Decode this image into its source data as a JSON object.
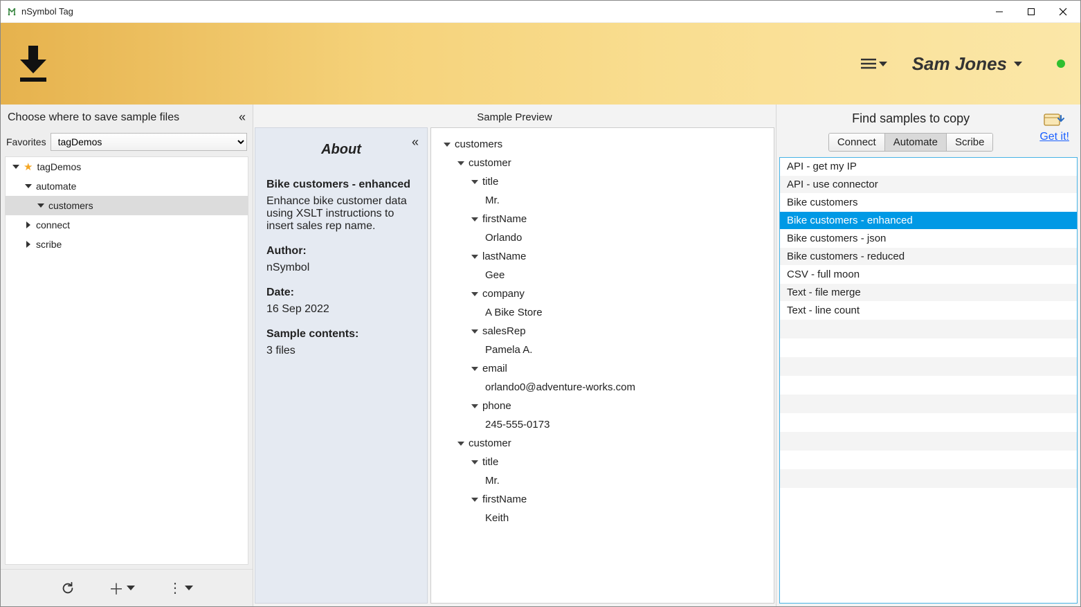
{
  "window": {
    "title": "nSymbol Tag"
  },
  "header": {
    "username": "Sam Jones"
  },
  "leftPanel": {
    "title": "Choose where to save sample files",
    "favoritesLabel": "Favorites",
    "favoritesSelected": "tagDemos",
    "tree": [
      {
        "label": "tagDemos",
        "depth": 0,
        "open": true,
        "starred": true
      },
      {
        "label": "automate",
        "depth": 1,
        "open": true
      },
      {
        "label": "customers",
        "depth": 2,
        "open": true,
        "selected": true
      },
      {
        "label": "connect",
        "depth": 1,
        "open": false
      },
      {
        "label": "scribe",
        "depth": 1,
        "open": false
      }
    ]
  },
  "preview": {
    "header": "Sample Preview"
  },
  "about": {
    "heading": "About",
    "title": "Bike customers - enhanced",
    "description": "Enhance bike customer data using XSLT instructions to insert sales rep name.",
    "authorLabel": "Author:",
    "author": "nSymbol",
    "dateLabel": "Date:",
    "date": "16 Sep 2022",
    "contentsLabel": "Sample contents:",
    "contents": "3 files"
  },
  "dataTree": [
    {
      "depth": 0,
      "label": "customers",
      "node": true
    },
    {
      "depth": 1,
      "label": "customer",
      "node": true
    },
    {
      "depth": 2,
      "label": "title",
      "node": true
    },
    {
      "depth": 3,
      "label": "Mr.",
      "node": false
    },
    {
      "depth": 2,
      "label": "firstName",
      "node": true
    },
    {
      "depth": 3,
      "label": "Orlando",
      "node": false
    },
    {
      "depth": 2,
      "label": "lastName",
      "node": true
    },
    {
      "depth": 3,
      "label": "Gee",
      "node": false
    },
    {
      "depth": 2,
      "label": "company",
      "node": true
    },
    {
      "depth": 3,
      "label": "A Bike Store",
      "node": false
    },
    {
      "depth": 2,
      "label": "salesRep",
      "node": true
    },
    {
      "depth": 3,
      "label": "Pamela A.",
      "node": false
    },
    {
      "depth": 2,
      "label": "email",
      "node": true
    },
    {
      "depth": 3,
      "label": "orlando0@adventure-works.com",
      "node": false
    },
    {
      "depth": 2,
      "label": "phone",
      "node": true
    },
    {
      "depth": 3,
      "label": "245-555-0173",
      "node": false
    },
    {
      "depth": 1,
      "label": "customer",
      "node": true
    },
    {
      "depth": 2,
      "label": "title",
      "node": true
    },
    {
      "depth": 3,
      "label": "Mr.",
      "node": false
    },
    {
      "depth": 2,
      "label": "firstName",
      "node": true
    },
    {
      "depth": 3,
      "label": "Keith",
      "node": false
    }
  ],
  "rightPanel": {
    "title": "Find samples to copy",
    "getIt": "Get it!",
    "tabs": [
      {
        "label": "Connect",
        "active": false
      },
      {
        "label": "Automate",
        "active": true
      },
      {
        "label": "Scribe",
        "active": false
      }
    ],
    "samples": [
      {
        "label": "API - get my IP"
      },
      {
        "label": "API - use connector"
      },
      {
        "label": "Bike customers"
      },
      {
        "label": "Bike customers - enhanced",
        "selected": true
      },
      {
        "label": "Bike customers - json"
      },
      {
        "label": "Bike customers - reduced"
      },
      {
        "label": "CSV - full moon"
      },
      {
        "label": "Text - file merge"
      },
      {
        "label": "Text - line count"
      }
    ]
  }
}
